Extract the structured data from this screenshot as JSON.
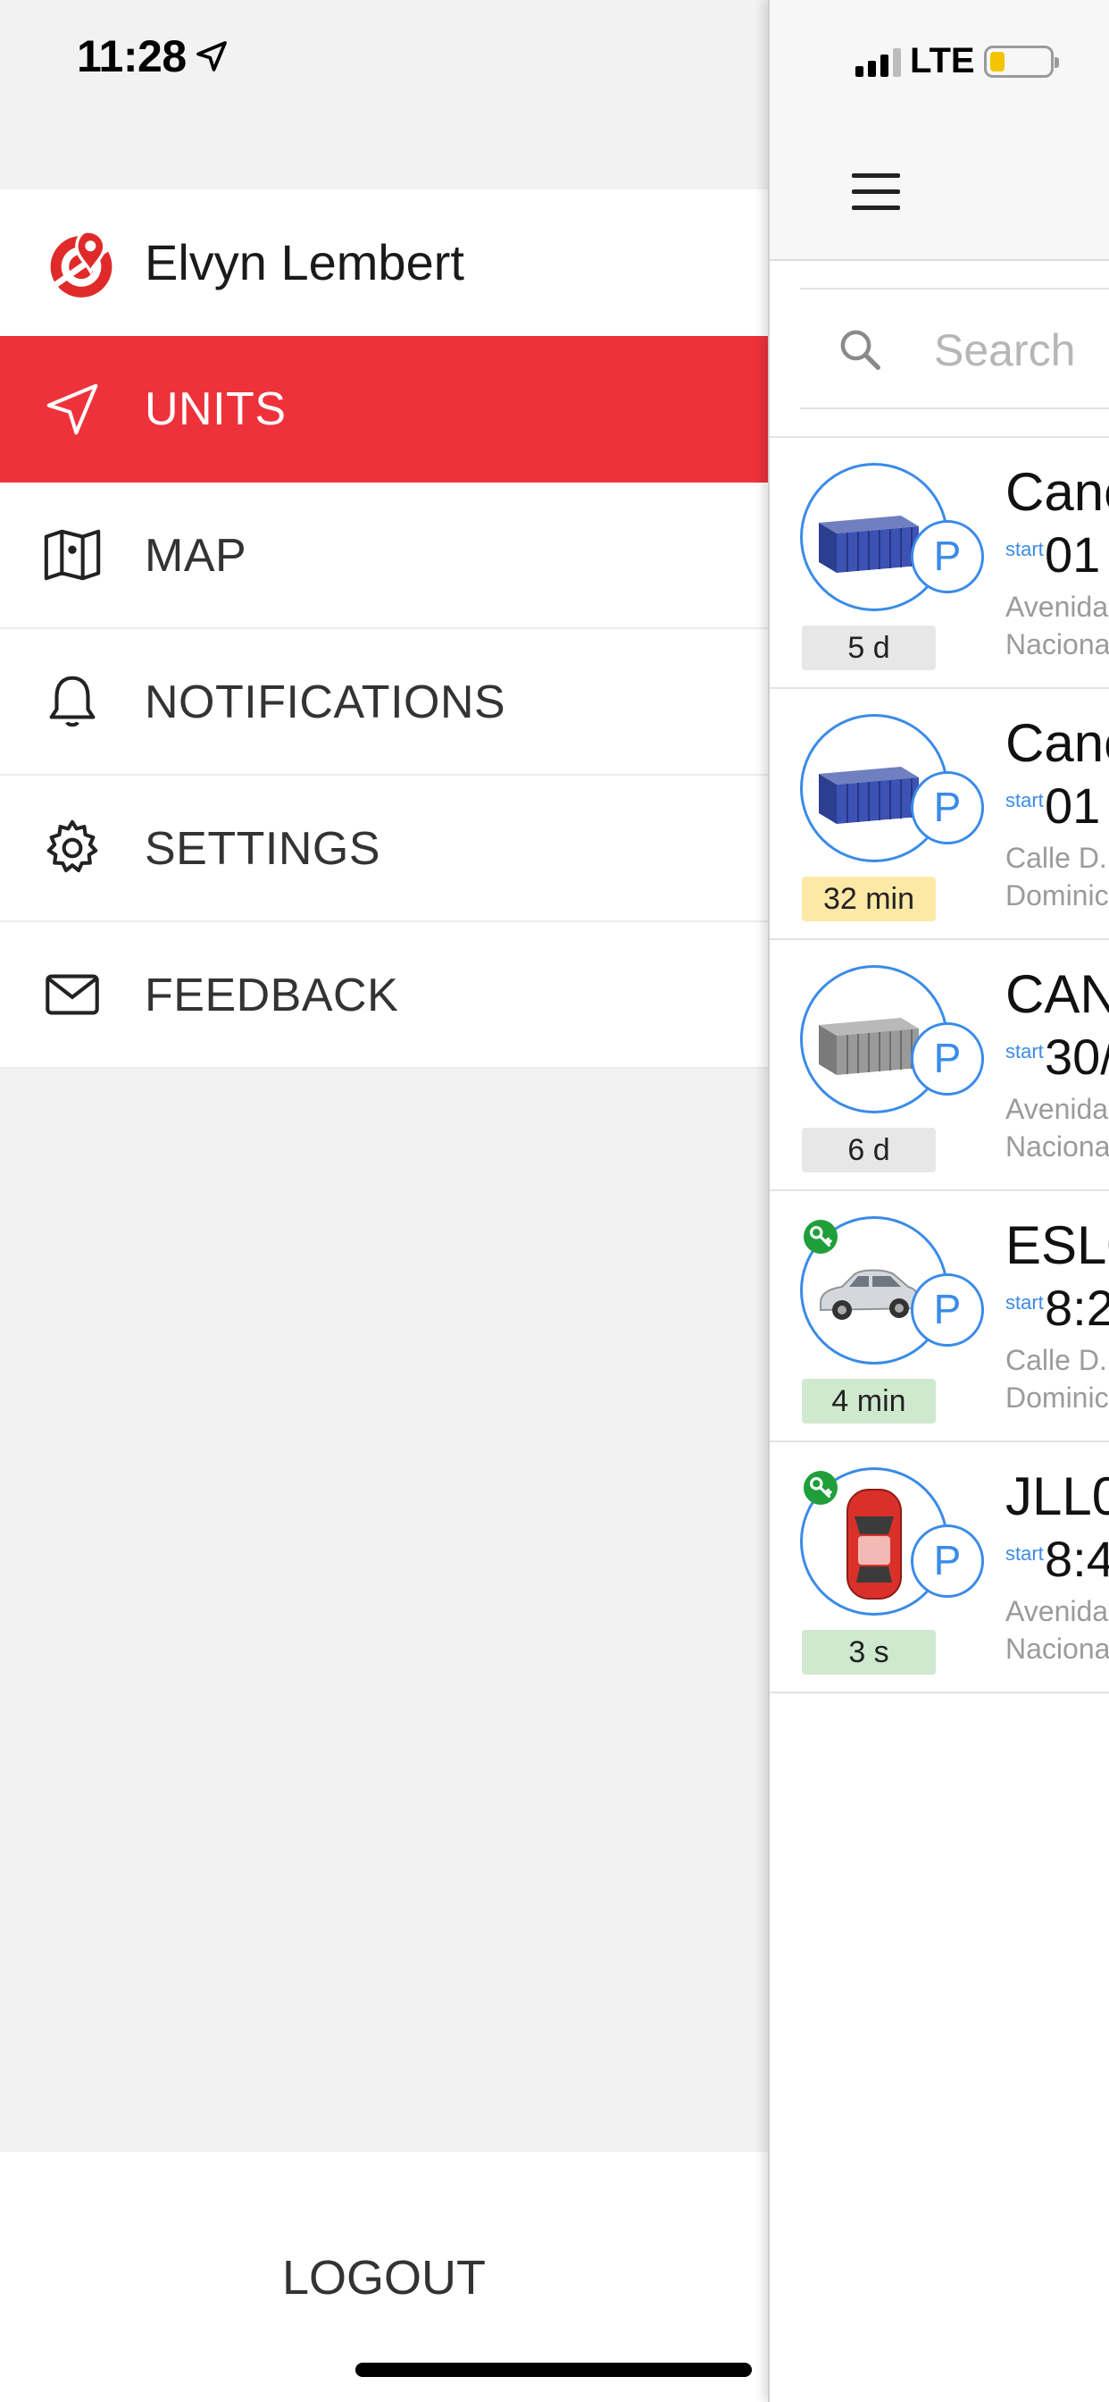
{
  "status_bar": {
    "time": "11:28",
    "network": "LTE",
    "battery_color": "#f5c400"
  },
  "drawer": {
    "user_name": "Elvyn Lembert",
    "menu": [
      {
        "label": "UNITS",
        "icon": "navigation-arrow-icon",
        "active": true
      },
      {
        "label": "MAP",
        "icon": "map-icon",
        "active": false
      },
      {
        "label": "NOTIFICATIONS",
        "icon": "bell-icon",
        "active": false
      },
      {
        "label": "SETTINGS",
        "icon": "gear-icon",
        "active": false
      },
      {
        "label": "FEEDBACK",
        "icon": "envelope-icon",
        "active": false
      }
    ],
    "logout_label": "LOGOUT",
    "accent_color": "#ee323b"
  },
  "units_screen": {
    "search_placeholder": "Search",
    "parking_badge": "P",
    "start_label": "start",
    "units": [
      {
        "name": "Canc",
        "start_time": "01",
        "address_line1": "Avenida",
        "address_line2": "Naciona",
        "duration": "5 d",
        "duration_color": "gray",
        "icon": "container-blue",
        "has_key": false
      },
      {
        "name": "Canc",
        "start_time": "01",
        "address_line1": "Calle D.",
        "address_line2": "Dominic",
        "duration": "32 min",
        "duration_color": "yellow",
        "icon": "container-blue",
        "has_key": false
      },
      {
        "name": "CAN",
        "start_time": "30/",
        "address_line1": "Avenida",
        "address_line2": "Naciona",
        "duration": "6 d",
        "duration_color": "gray",
        "icon": "container-gray",
        "has_key": false
      },
      {
        "name": "ESL0",
        "start_time": "8:2",
        "address_line1": "Calle D.",
        "address_line2": "Dominic",
        "duration": "4 min",
        "duration_color": "green",
        "icon": "car-silver",
        "has_key": true
      },
      {
        "name": "JLL0",
        "start_time": "8:4",
        "address_line1": "Avenida",
        "address_line2": "Naciona",
        "duration": "3 s",
        "duration_color": "green",
        "icon": "car-red-top",
        "has_key": true
      }
    ]
  }
}
